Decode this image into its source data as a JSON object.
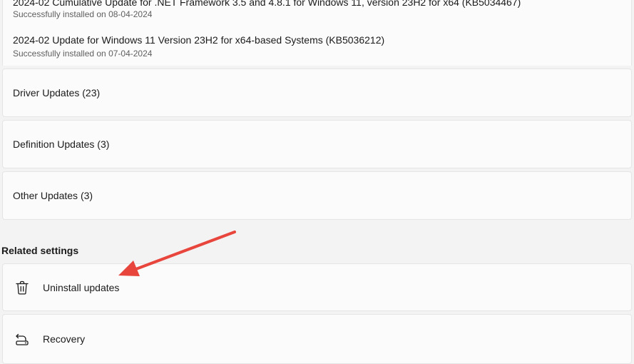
{
  "update_history": {
    "items": [
      {
        "title": "2024-02 Cumulative Update for .NET Framework 3.5 and 4.8.1 for Windows 11, version 23H2 for x64 (KB5034467)",
        "status": "Successfully installed on 08-04-2024"
      },
      {
        "title": "2024-02 Update for Windows 11 Version 23H2 for x64-based Systems (KB5036212)",
        "status": "Successfully installed on 07-04-2024"
      }
    ],
    "categories": [
      {
        "label": "Driver Updates (23)"
      },
      {
        "label": "Definition Updates (3)"
      },
      {
        "label": "Other Updates (3)"
      }
    ]
  },
  "related_settings": {
    "heading": "Related settings",
    "items": [
      {
        "label": "Uninstall updates",
        "icon": "trash-icon"
      },
      {
        "label": "Recovery",
        "icon": "recovery-icon"
      }
    ]
  },
  "annotation": {
    "color": "#e8453c"
  }
}
